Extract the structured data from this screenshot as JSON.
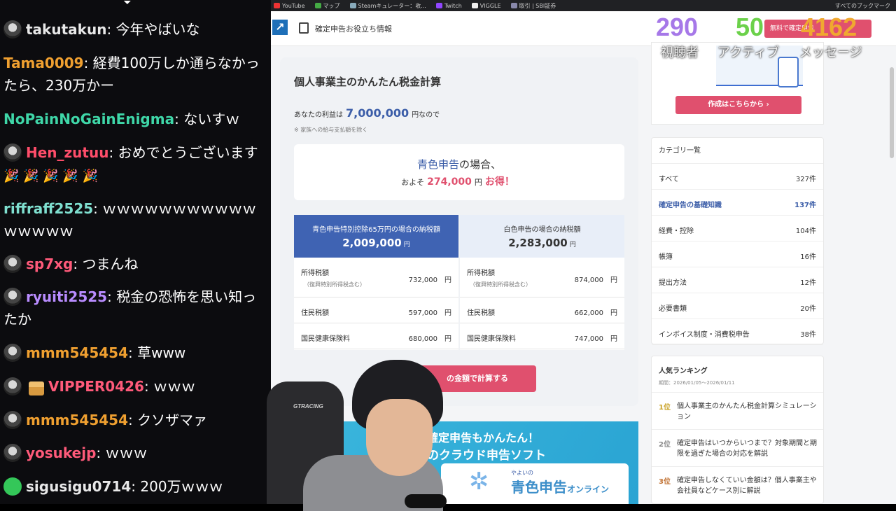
{
  "chat": {
    "messages": [
      {
        "user": "takutakun",
        "user_color": "#e8e8e8",
        "badge": "avatar",
        "text": "今年やばいな"
      },
      {
        "user": "Tama0009",
        "user_color": "#f0a030",
        "badge": "",
        "text": "経費100万しか通らなかったら、230万かー"
      },
      {
        "user": "NoPainNoGainEnigma",
        "user_color": "#3fd7a8",
        "badge": "",
        "text": "ないすｗ"
      },
      {
        "user": "Hen_zutuu",
        "user_color": "#ff4d6a",
        "badge": "avatar",
        "text": "おめでとうございます",
        "emotes": "🎉 🎉 🎉 🎉 🎉"
      },
      {
        "user": "riffraff2525",
        "user_color": "#7fe0d0",
        "badge": "",
        "text": "ｗｗｗｗｗｗｗｗｗｗｗｗｗｗｗｗ"
      },
      {
        "user": "sp7xg",
        "user_color": "#ff5a7a",
        "badge": "avatar",
        "text": "つまんね"
      },
      {
        "user": "ryuiti2525",
        "user_color": "#b98cff",
        "badge": "avatar",
        "text": "税金の恐怖を思い知ったか"
      },
      {
        "user": "mmm545454",
        "user_color": "#f0a030",
        "badge": "avatar",
        "text": "草www"
      },
      {
        "user": "VIPPER0426",
        "user_color": "#ff5a7a",
        "badge": "avatar+gift",
        "text": "ｗｗｗ"
      },
      {
        "user": "mmm545454",
        "user_color": "#f0a030",
        "badge": "avatar",
        "text": "クソザマァ"
      },
      {
        "user": "yosukejp",
        "user_color": "#ff5a7a",
        "badge": "avatar",
        "text": "ｗｗｗ"
      },
      {
        "user": "sigusigu0714",
        "user_color": "#e8e8e8",
        "badge": "check",
        "text": "200万ｗｗｗ"
      }
    ]
  },
  "bookmarks": [
    {
      "label": "YouTube",
      "color": "#e33"
    },
    {
      "label": "マップ",
      "color": "#4a4"
    },
    {
      "label": "Steamキュレーター：收...",
      "color": "#8ab"
    },
    {
      "label": "Twitch",
      "color": "#9146ff"
    },
    {
      "label": "VIGGLE",
      "color": "#eee"
    },
    {
      "label": "取引 | SBI証券",
      "color": "#88a"
    }
  ],
  "bookmarks_right": "すべてのブックマーク",
  "header": {
    "nav_label": "確定申告お役立ち情報",
    "free_btn": "無料で確定申告"
  },
  "stats": {
    "viewers": {
      "value": "290",
      "label": "視聴者",
      "color": "#a678e8"
    },
    "active": {
      "value": "50",
      "label": "アクティブ",
      "color": "#6bd14a"
    },
    "messages": {
      "value": "4162",
      "label": "メッセージ",
      "color": "#f0a830"
    }
  },
  "calc": {
    "title": "個人事業主のかんたん税金計算",
    "profit_prefix": "あなたの利益は",
    "profit_amount": "7,000,000",
    "profit_suffix": "円なので",
    "note": "※ 家族への給与支払額を除く",
    "savings_blue": "青色申告",
    "savings_l1_suffix": "の場合、",
    "savings_prefix": "およそ",
    "savings_amount": "274,000",
    "savings_unit": "円",
    "savings_suffix": "お得！",
    "blue_col": {
      "title": "青色申告特別控除65万円の場合の納税額",
      "total": "2,009,000",
      "unit": "円",
      "rows": [
        {
          "label": "所得税額",
          "sub": "（復興特別所得税含む）",
          "value": "732,000",
          "unit": "円"
        },
        {
          "label": "住民税額",
          "sub": "",
          "value": "597,000",
          "unit": "円"
        },
        {
          "label": "国民健康保険料",
          "sub": "",
          "value": "680,000",
          "unit": "円"
        }
      ]
    },
    "white_col": {
      "title": "白色申告の場合の納税額",
      "total": "2,283,000",
      "unit": "円",
      "rows": [
        {
          "label": "所得税額",
          "sub": "（復興特別所得税含む）",
          "value": "874,000",
          "unit": "円"
        },
        {
          "label": "住民税額",
          "sub": "",
          "value": "662,000",
          "unit": "円"
        },
        {
          "label": "国民健康保険料",
          "sub": "",
          "value": "747,000",
          "unit": "円"
        }
      ]
    },
    "button": "の金額で計算する"
  },
  "banner": {
    "line1": "確定申告もかんたん！",
    "line2": "のクラウド申告ソフト",
    "brand_small": "やよいの",
    "brand": "青色申告",
    "brand_suffix": "オンライン"
  },
  "promo": {
    "button": "作成はこちらから"
  },
  "categories": {
    "heading": "カテゴリ一覧",
    "items": [
      {
        "name": "すべて",
        "count": "327件"
      },
      {
        "name": "確定申告の基礎知識",
        "count": "137件"
      },
      {
        "name": "経費・控除",
        "count": "104件"
      },
      {
        "name": "帳簿",
        "count": "16件"
      },
      {
        "name": "提出方法",
        "count": "12件"
      },
      {
        "name": "必要書類",
        "count": "20件"
      },
      {
        "name": "インボイス制度・消費税申告",
        "count": "38件"
      }
    ]
  },
  "ranking": {
    "heading": "人気ランキング",
    "period": "期間：2026/01/05〜2026/01/11",
    "items": [
      {
        "pos": "1位",
        "text": "個人事業主のかんたん税金計算シミュレーション"
      },
      {
        "pos": "2位",
        "text": "確定申告はいつからいつまで？対象期間と期限を過ぎた場合の対応を解説"
      },
      {
        "pos": "3位",
        "text": "確定申告しなくていい金額は？個人事業主や会社員などケース別に解説"
      }
    ]
  },
  "webcam": {
    "chair_brand": "GTRACING"
  }
}
